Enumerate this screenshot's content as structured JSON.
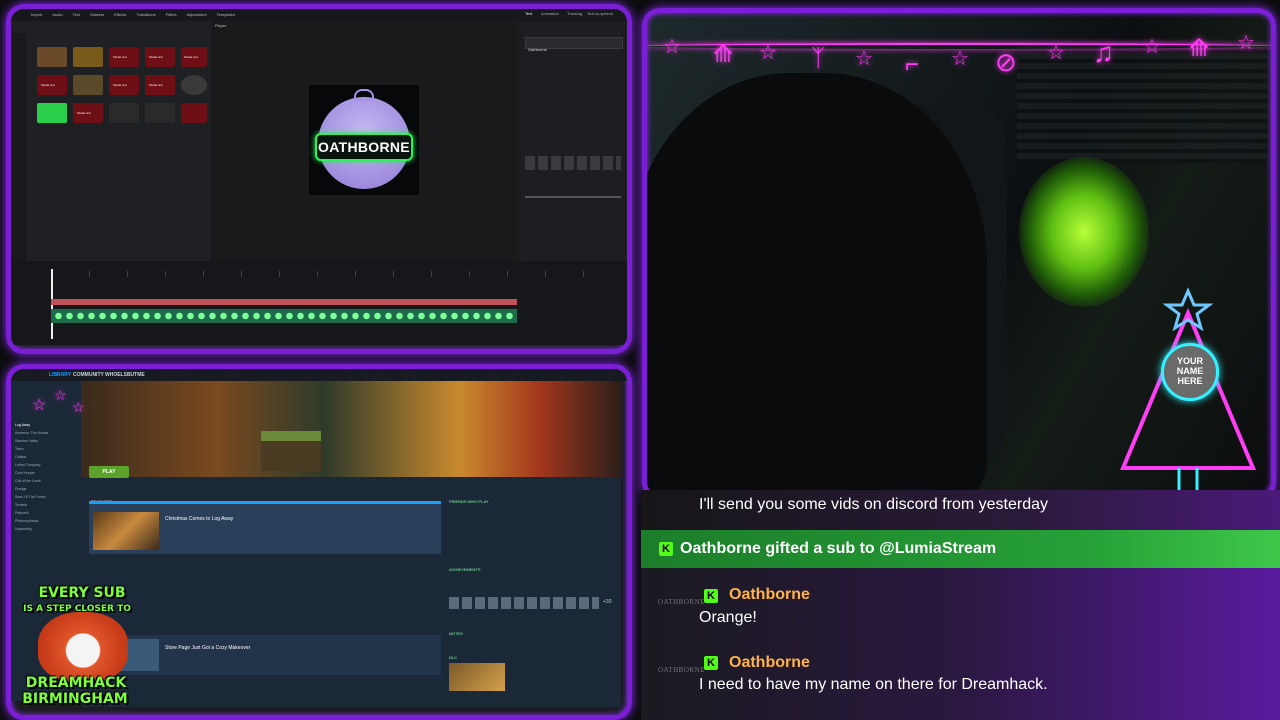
{
  "editor": {
    "menu": [
      "Import",
      "Audio",
      "Text",
      "Stickers",
      "Effects",
      "Transitions",
      "Filters",
      "Adjustment",
      "Templates"
    ],
    "player_title": "Player",
    "preview_label": "OATHBORNE",
    "tile_labels": [
      "Media text",
      "Media text",
      "Media text",
      "Media text",
      "Media text",
      "Media text",
      "Media text"
    ],
    "right_tabs": [
      "Text",
      "Animation",
      "Tracking",
      "Text-to-speech"
    ],
    "right_field": "Oathborne"
  },
  "steam": {
    "nav": [
      "LIBRARY",
      "COMMUNITY",
      "WHOELSBUTME"
    ],
    "sidebar_items": [
      "Log Away",
      "Amnesia: The Bunker",
      "Stardew Valley",
      "Toem",
      "Outlast",
      "Lethal Company",
      "Core Keeper",
      "Cult of the Lamb",
      "Dredge",
      "Sons Of The Forest",
      "Terraria",
      "Palworld",
      "Phasmophobia",
      "Unpacking"
    ],
    "play_label": "PLAY",
    "section_featured": "FEATURED",
    "news_title": "Christmas Comes to Log Away",
    "news2_title": "Store Page Just Got a Cozy Makeover",
    "friends_title": "FRIENDS WHO PLAY",
    "achievements_title": "ACHIEVEMENTS",
    "notes_title": "NOTES",
    "dlc_title": "DLC",
    "achievements_more": "+30"
  },
  "promo": {
    "line1": "EVERY SUB",
    "line2": "IS A STEP CLOSER TO",
    "line3": "DREAMHACK",
    "line4": "BIRMINGHAM"
  },
  "overlay": {
    "name_ball": "YOUR NAME HERE",
    "garland_icons": [
      "star-icon",
      "tree-icon",
      "star-icon",
      "reindeer-icon",
      "star-icon",
      "stocking-icon",
      "star-icon",
      "ornament-icon",
      "star-icon",
      "bell-icon",
      "star-icon",
      "tree-icon",
      "star-icon"
    ]
  },
  "chat": {
    "partial_message": "I'll send you some vids on discord from yesterday",
    "gift_event": "Oathborne gifted a sub to @LumiaStream",
    "messages": [
      {
        "user": "Oathborne",
        "text": "Orange!"
      },
      {
        "user": "Oathborne",
        "text": "I need to have my name on there for Dreamhack."
      }
    ],
    "avatar_text": "OATHBORNE",
    "badge": "K"
  },
  "colors": {
    "frame": "#7b1fd6",
    "kick_green": "#53fc18",
    "neon_pink": "#ff3df5",
    "neon_cyan": "#35f0ff",
    "steam_play": "#5ba32b"
  }
}
